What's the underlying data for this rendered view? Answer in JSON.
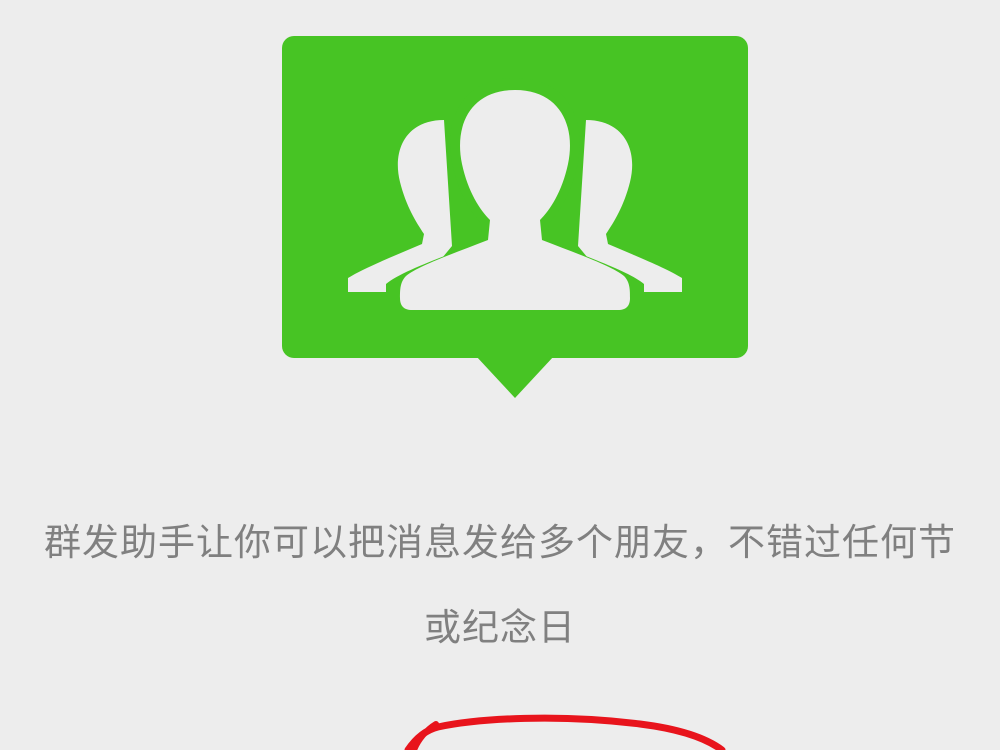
{
  "intro": {
    "icon": "group-chat-bubble-icon",
    "description_line1": "群发助手让你可以把消息发给多个朋友，不错过任何节",
    "description_line2": "或纪念日"
  },
  "colors": {
    "background": "#ededed",
    "brand_green": "#47c424",
    "text_secondary": "#808080",
    "annotation_red": "#e8141c"
  }
}
